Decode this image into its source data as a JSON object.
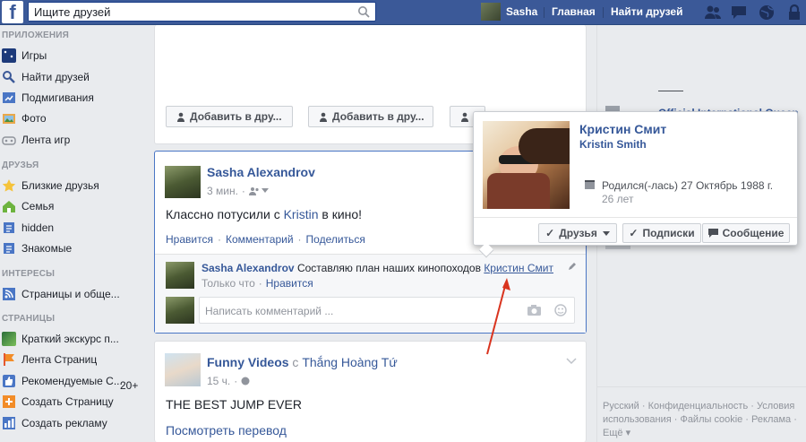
{
  "topbar": {
    "logo": "f",
    "search_placeholder": "Ищите друзей",
    "user_name": "Sasha",
    "home": "Главная",
    "find_friends": "Найти друзей"
  },
  "leftnav": {
    "apps_header": "ПРИЛОЖЕНИЯ",
    "apps": [
      {
        "label": "Игры",
        "icon": "games-icon"
      },
      {
        "label": "Найти друзей",
        "icon": "find-friends-icon"
      },
      {
        "label": "Подмигивания",
        "icon": "pokes-icon"
      },
      {
        "label": "Фото",
        "icon": "photos-icon"
      },
      {
        "label": "Лента игр",
        "icon": "games-feed-icon"
      }
    ],
    "friends_header": "ДРУЗЬЯ",
    "friends": [
      {
        "label": "Близкие друзья",
        "icon": "star-icon"
      },
      {
        "label": "Семья",
        "icon": "family-icon"
      },
      {
        "label": "hidden",
        "icon": "list-icon"
      },
      {
        "label": "Знакомые",
        "icon": "acquaintances-icon"
      }
    ],
    "interests_header": "ИНТЕРЕСЫ",
    "interests": [
      {
        "label": "Страницы и обще...",
        "icon": "rss-icon"
      }
    ],
    "pages_header": "СТРАНИЦЫ",
    "pages": [
      {
        "label": "Краткий экскурс п...",
        "icon": "page-thumb-icon"
      },
      {
        "label": "Лента Страниц",
        "icon": "flag-icon",
        "count": "20+"
      },
      {
        "label": "Рекомендуемые С...",
        "icon": "like-icon"
      },
      {
        "label": "Создать Страницу",
        "icon": "create-page-icon"
      },
      {
        "label": "Создать рекламу",
        "icon": "ads-icon"
      }
    ]
  },
  "suggestions": {
    "add_friend_1": "Добавить в дру...",
    "add_friend_2": "Добавить в дру..."
  },
  "post1": {
    "author": "Sasha Alexandrov",
    "time": "3 мин.",
    "text_before": "Классно потусили с ",
    "text_link": "Kristin",
    "text_after": " в кино!",
    "like": "Нравится",
    "comment": "Комментарий",
    "share": "Поделиться",
    "comment_author": "Sasha Alexandrov",
    "comment_text": " Составляю план наших кинопоходов ",
    "comment_link": "Кристин Смит",
    "comment_time": "Только что",
    "comment_like": "Нравится",
    "comment_placeholder": "Написать комментарий ..."
  },
  "post2": {
    "author": "Funny Videos",
    "with": " с ",
    "tagged": "Thắng Hoàng Tứ",
    "time": "15 ч.",
    "text": "THE BEST JUMP EVER",
    "translate": "Посмотреть перевод"
  },
  "hovercard": {
    "name": "Кристин Смит",
    "alt_name": "Kristin Smith",
    "birth": "Родился(-лась) 27 Октябрь 1988 г.",
    "age": "26 лет",
    "friends_btn": "Друзья",
    "follow_btn": "Подписки",
    "message_btn": "Сообщение"
  },
  "rightcol": {
    "partial_title": "Official International Queen"
  },
  "footer": {
    "line1": "Русский · Конфиденциальность · Условия",
    "line2": "использования · Файлы cookie · Реклама ·",
    "line3": "Ещё"
  },
  "colors": {
    "brand": "#3b5998",
    "link": "#365899",
    "arrow": "#d9341f"
  }
}
